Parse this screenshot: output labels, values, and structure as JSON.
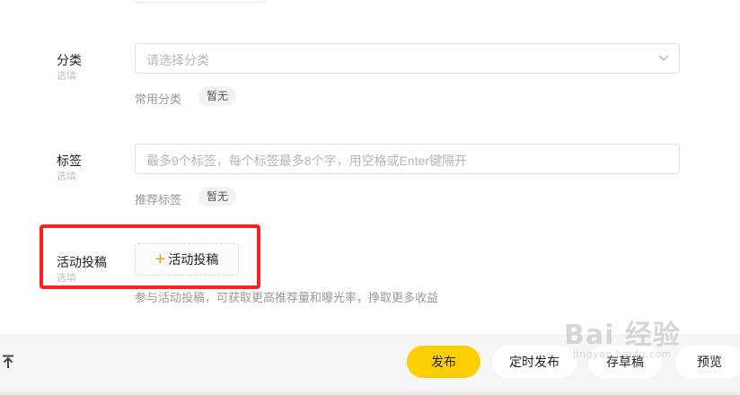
{
  "category": {
    "label": "分类",
    "sub": "选填",
    "placeholder": "请选择分类",
    "common_label": "常用分类",
    "common_chip": "暂无"
  },
  "tags": {
    "label": "标签",
    "sub": "选填",
    "placeholder": "最多9个标签，每个标签最多8个字，用空格或Enter键隔开",
    "recommend_label": "推荐标签",
    "recommend_chip": "暂无"
  },
  "activity": {
    "label": "活动投稿",
    "sub": "选填",
    "button_label": "活动投稿",
    "note": "参与活动投稿，可获取更高推荐量和曝光率，挣取更多收益"
  },
  "bottom_bar": {
    "top_icon": "arrow-up-to-top",
    "publish": "发布",
    "schedule": "定时发布",
    "draft": "存草稿",
    "preview": "预览"
  },
  "watermark": {
    "main": "Bai 经验",
    "sub": "jingyan.baidu.com"
  },
  "colors": {
    "accent": "#ffcf00",
    "highlight": "#ff2020",
    "plus": "#f2a500"
  }
}
